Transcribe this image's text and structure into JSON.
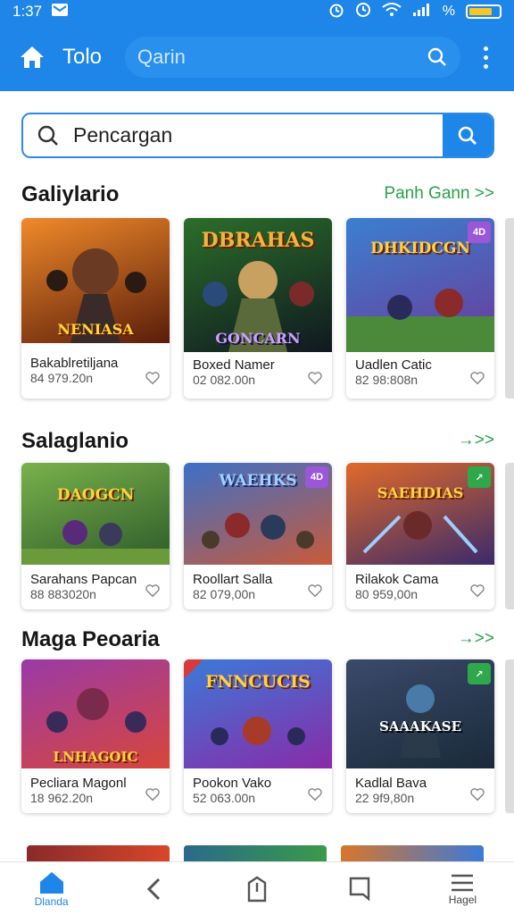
{
  "status": {
    "time": "1:37",
    "battery_level": 0.78
  },
  "appbar": {
    "title": "Tolo",
    "search_placeholder": "Qarin"
  },
  "search": {
    "value": "Pencargan"
  },
  "sections": [
    {
      "title": "Galiylario",
      "link": "Panh Gann >>",
      "cards": [
        {
          "name": "Bakablretiljana",
          "count": "84 979.20n",
          "art": "NENIASA",
          "colors": [
            "#f08a2a",
            "#5a1d0a"
          ]
        },
        {
          "name": "Boxed Namer",
          "count": "02 082.00n",
          "art": "GONCARN",
          "colors": [
            "#2b6e2a",
            "#101820"
          ]
        },
        {
          "name": "Uadlen Catic",
          "count": "82 98:808n",
          "art": "DHKIDCGN",
          "colors": [
            "#3b7fd0",
            "#6a3b9a"
          ],
          "badge": "4D"
        }
      ]
    },
    {
      "title": "Salaglanio",
      "link": "→>>",
      "cards": [
        {
          "name": "Sarahans Papcan",
          "count": "88 883020n",
          "art": "DAOGCN",
          "colors": [
            "#79b24a",
            "#2d5a2a"
          ]
        },
        {
          "name": "Roollart Salla",
          "count": "82 079,00n",
          "art": "WAEHKS",
          "colors": [
            "#3c70c8",
            "#c85a3a"
          ],
          "badge": "4D"
        },
        {
          "name": "Rilakok Cama",
          "count": "80 959,00n",
          "art": "SAEHDIAS",
          "colors": [
            "#e06a2a",
            "#3b2a6a"
          ],
          "badge": "↗"
        }
      ]
    },
    {
      "title": "Maga Peoaria",
      "link": "→>>",
      "cards": [
        {
          "name": "Pecliara Magonl",
          "count": "18 962.20n",
          "art": "LNHAGOIC",
          "colors": [
            "#9a3aa8",
            "#d8463a"
          ]
        },
        {
          "name": "Pookon Vako",
          "count": "52 063.00n",
          "art": "FNNCUCIS",
          "colors": [
            "#3a7ad8",
            "#8a2aa8"
          ]
        },
        {
          "name": "Kadlal Bava",
          "count": "22 9f9,80n",
          "art": "SAAAKASE",
          "colors": [
            "#3a4a6a",
            "#1a2a3a"
          ],
          "badge": "↗"
        }
      ]
    }
  ],
  "bottomnav": {
    "home": "Dlanda",
    "menu": "Hagel"
  }
}
